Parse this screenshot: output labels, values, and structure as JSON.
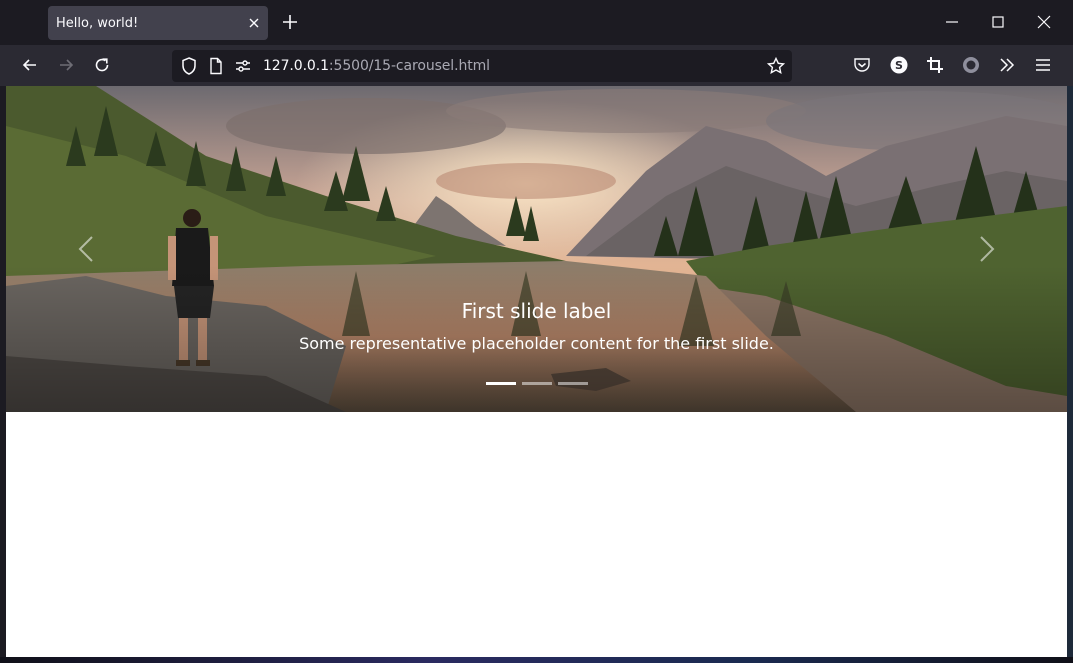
{
  "browser": {
    "tab_title": "Hello, world!",
    "url_host": "127.0.0.1",
    "url_rest": ":5500/15-carousel.html",
    "icons": {
      "new_tab": "plus-icon",
      "tab_close": "close-icon",
      "back": "arrow-left-icon",
      "forward": "arrow-right-icon",
      "reload": "reload-icon",
      "shield": "shield-icon",
      "page": "page-icon",
      "permissions": "permissions-icon",
      "bookmark": "star-icon",
      "pocket": "pocket-icon",
      "account": "s-badge-icon",
      "screenshot": "crop-icon",
      "extension": "circle-icon",
      "overflow": "double-chevron-icon",
      "menu": "hamburger-icon",
      "minimize": "minimize-icon",
      "maximize": "maximize-icon",
      "close_window": "close-window-icon"
    },
    "colors": {
      "chrome_dark": "#1c1b22",
      "toolbar": "#2b2a33",
      "tab_active": "#42414d",
      "text": "#fbfbfe"
    }
  },
  "carousel": {
    "slide_title": "First slide label",
    "slide_text": "Some representative placeholder content for the first slide.",
    "indicators": 3,
    "active_indicator": 1,
    "image": "mountain-lake-sunset-hiker-image"
  },
  "account_badge": "S"
}
